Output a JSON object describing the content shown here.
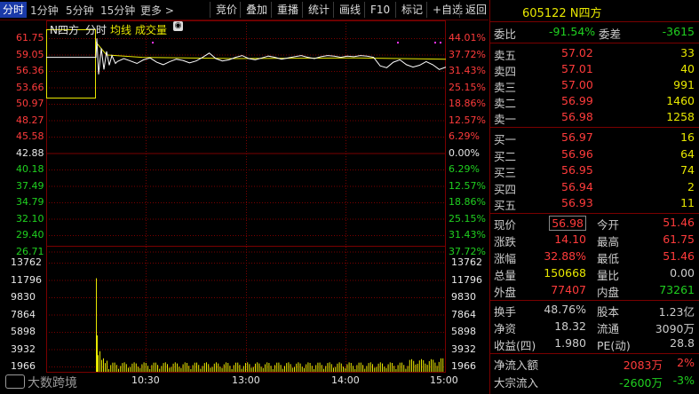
{
  "toolbar": {
    "tabs": [
      "分时",
      "1分钟",
      "5分钟",
      "15分钟",
      "更多 >"
    ],
    "buttons": [
      "竞价",
      "叠加",
      "重播",
      "统计",
      "画线",
      "F10",
      "标记",
      "+自选",
      "返回"
    ]
  },
  "chart": {
    "stock_name": "N四方",
    "legend": [
      "分时",
      "均线",
      "成交量"
    ],
    "price_ticks": [
      "61.75",
      "59.05",
      "56.36",
      "53.66",
      "50.97",
      "48.27",
      "45.58",
      "42.88",
      "40.18",
      "37.49",
      "34.79",
      "32.10",
      "29.40",
      "26.71"
    ],
    "pct_ticks": [
      "44.01%",
      "37.72%",
      "31.43%",
      "25.15%",
      "18.86%",
      "12.57%",
      "6.29%",
      "0.00%",
      "6.29%",
      "12.57%",
      "18.86%",
      "25.15%",
      "31.43%",
      "37.72%"
    ],
    "vol_ticks": [
      "13762",
      "11796",
      "9830",
      "7864",
      "5898",
      "3932",
      "1966"
    ],
    "time_ticks": [
      "10:30",
      "13:00",
      "14:00",
      "15:00"
    ],
    "colors": {
      "up": "#ff3b3b",
      "down": "#20d020",
      "flat": "#e8e8e8",
      "grid": "#7a0000",
      "price_line": "#ffffff",
      "avg_line": "#e8e800"
    }
  },
  "panel": {
    "code_name": "605122 N四方",
    "weibi": {
      "label": "委比",
      "value": "-91.54%",
      "label2": "委差",
      "value2": "-3615"
    },
    "asks": [
      {
        "label": "卖五",
        "price": "57.02",
        "vol": "33"
      },
      {
        "label": "卖四",
        "price": "57.01",
        "vol": "40"
      },
      {
        "label": "卖三",
        "price": "57.00",
        "vol": "991"
      },
      {
        "label": "卖二",
        "price": "56.99",
        "vol": "1460"
      },
      {
        "label": "卖一",
        "price": "56.98",
        "vol": "1258"
      }
    ],
    "bids": [
      {
        "label": "买一",
        "price": "56.97",
        "vol": "16"
      },
      {
        "label": "买二",
        "price": "56.96",
        "vol": "64"
      },
      {
        "label": "买三",
        "price": "56.95",
        "vol": "74"
      },
      {
        "label": "买四",
        "price": "56.94",
        "vol": "2"
      },
      {
        "label": "买五",
        "price": "56.93",
        "vol": "11"
      }
    ],
    "quote": [
      {
        "l1": "现价",
        "v1": "56.98",
        "l2": "今开",
        "v2": "51.46"
      },
      {
        "l1": "涨跌",
        "v1": "14.10",
        "l2": "最高",
        "v2": "61.75"
      },
      {
        "l1": "涨幅",
        "v1": "32.88%",
        "l2": "最低",
        "v2": "51.46"
      },
      {
        "l1": "总量",
        "v1": "150668",
        "l2": "量比",
        "v2": "0.00"
      },
      {
        "l1": "外盘",
        "v1": "77407",
        "l2": "内盘",
        "v2": "73261"
      }
    ],
    "stats": [
      {
        "l1": "换手",
        "v1": "48.76%",
        "l2": "股本",
        "v2": "1.23亿"
      },
      {
        "l1": "净资",
        "v1": "18.32",
        "l2": "流通",
        "v2": "3090万"
      },
      {
        "l1": "收益(四)",
        "v1": "1.980",
        "l2": "PE(动)",
        "v2": "28.8"
      }
    ],
    "flows": [
      {
        "label": "净流入额",
        "value": "2083万",
        "pct": "2%"
      },
      {
        "label": "大宗流入",
        "value": "-2600万",
        "pct": "-3%"
      }
    ]
  },
  "watermark": "大数跨境"
}
